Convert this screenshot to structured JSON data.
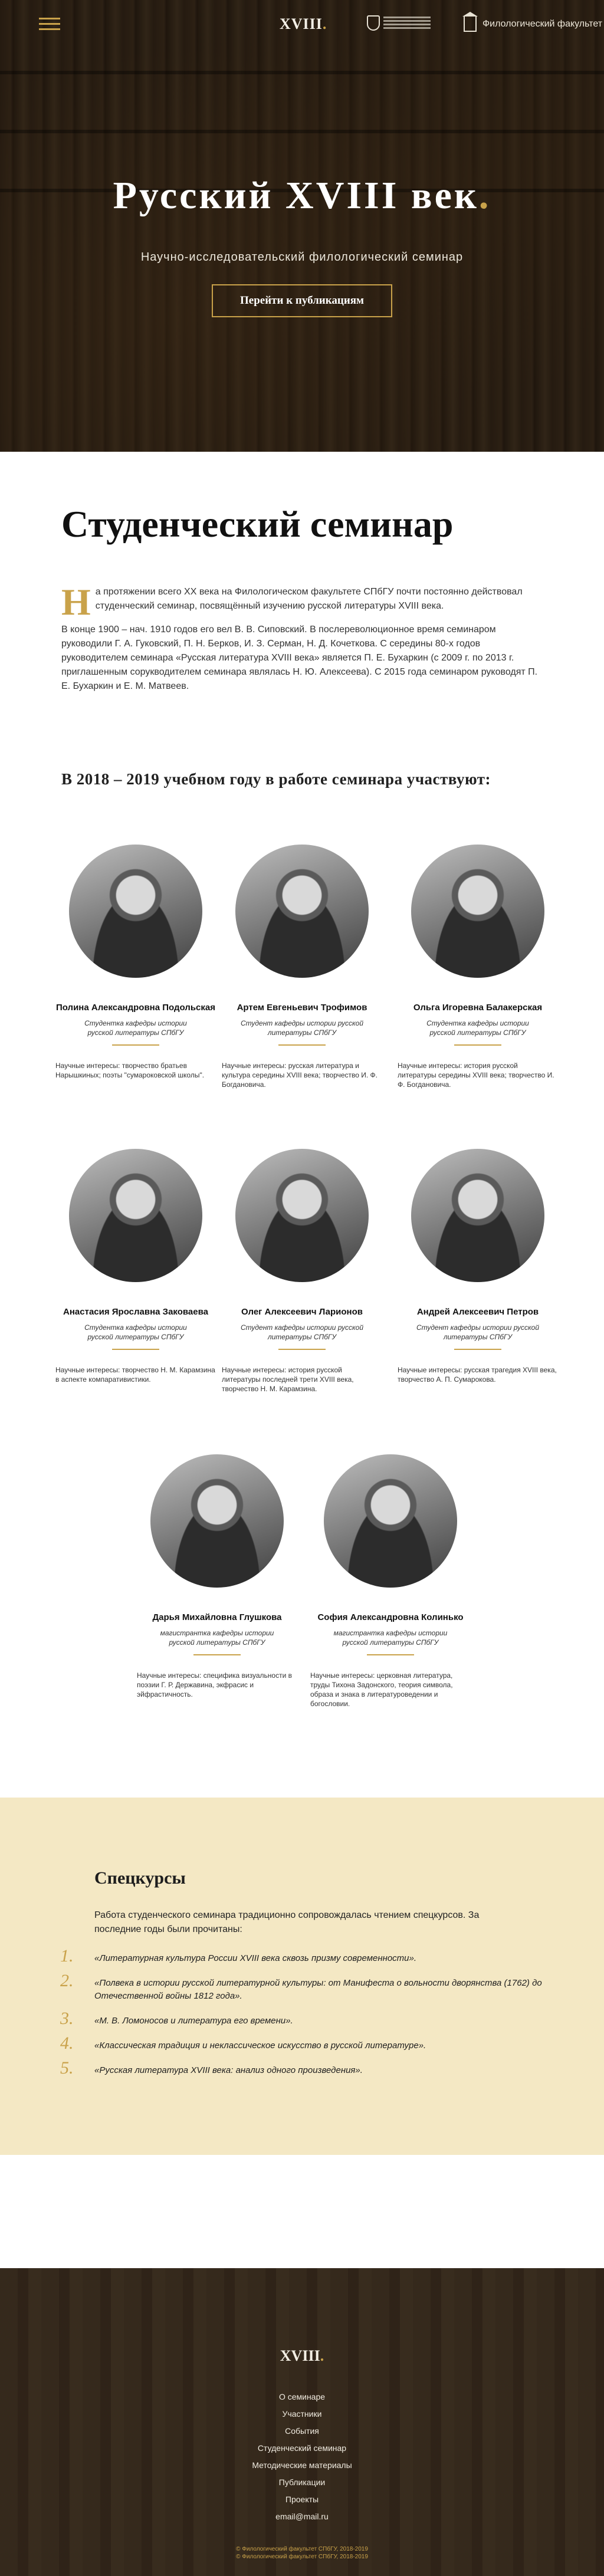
{
  "hero": {
    "logo_text": "XVIII",
    "logo_dot": ".",
    "faculty": "Филологический факультет",
    "title": "Русский XVIII век",
    "title_dot": ".",
    "subtitle": "Научно-исследовательский филологический семинар",
    "button": "Перейти к публикациям"
  },
  "intro": {
    "heading": "Студенческий семинар",
    "dropcap": "Н",
    "paragraph1": "а протяжении всего XX века на Филологическом факультете СПбГУ почти постоянно действовал студенческий семинар, посвящённый изучению русской литературы XVIII века.",
    "paragraph2": "В конце 1900 – нач. 1910 годов его вел В. В. Сиповский. В послереволюционное время семинаром руководили Г. А. Гуковский, П. Н. Берков, И. З. Серман, Н. Д. Кочеткова. С середины 80-х годов руководителем семинара «Русская литература XVIII века» является П. Е. Бухаркин (с 2009 г. по 2013 г. приглашенным сорукводителем семинара являлась Н. Ю. Алексеева). С 2015 года семинаром руководят П. Е. Бухаркин и Е. М. Матвеев.",
    "year_heading": "В 2018 – 2019 учебном году в работе семинара участвуют:"
  },
  "people": [
    {
      "name": "Полина Александровна Подольская",
      "role": "Студентка кафедры истории русской литературы СПбГУ",
      "interests": "Научные интересы: творчество братьев Нарышкиных; поэты \"сумароковской школы\"."
    },
    {
      "name": "Артем Евгеньевич Трофимов",
      "role": "Студент кафедры истории русской литературы СПбГУ",
      "interests": "Научные интересы: русская литература и культура середины XVIII века; творчество И. Ф. Богдановича."
    },
    {
      "name": "Ольга Игоревна Балакерская",
      "role": "Студентка кафедры истории русской литературы СПбГУ",
      "interests": "Научные интересы: история русской литературы середины XVIII века; творчество И. Ф. Богдановича."
    },
    {
      "name": "Анастасия Ярославна Заковаева",
      "role": "Студентка кафедры истории русской литературы СПбГУ",
      "interests": "Научные интересы: творчество Н. М. Карамзина в аспекте компаративистики."
    },
    {
      "name": "Олег Алексеевич Ларионов",
      "role": "Студент кафедры истории русской литературы СПбГУ",
      "interests": "Научные интересы: история русской литературы последней трети XVIII века, творчество Н. М. Карамзина."
    },
    {
      "name": "Андрей Алексеевич Петров",
      "role": "Студент кафедры истории русской литературы СПбГУ",
      "interests": "Научные интересы: русская трагедия XVIII века, творчество А. П. Сумарокова."
    },
    {
      "name": "Дарья Михайловна Глушкова",
      "role": "магистрантка кафедры истории русской литературы СПбГУ",
      "interests": "Научные интересы: специфика визуальности в поэзии Г. Р. Державина, экфрасис и эйфрастичность."
    },
    {
      "name": "София Александровна Колинько",
      "role": "магистрантка кафедры истории русской литературы СПбГУ",
      "interests": "Научные интересы: церковная литература, труды Тихона Задонского, теория символа, образа и знака в литературоведении и богословии."
    }
  ],
  "courses": {
    "heading": "Спецкурсы",
    "lead": "Работа студенческого семинара традиционно сопровождалась чтением спецкурсов. За последние годы были прочитаны:",
    "items": [
      {
        "num": "1.",
        "text": "«Литературная культура России XVIII века сквозь призму современности»."
      },
      {
        "num": "2.",
        "text": "«Полвека в истории русской литературной культуры: от Манифеста  о вольности дворянства (1762) до Отечественной войны 1812 года»."
      },
      {
        "num": "3.",
        "text": "«М. В. Ломоносов и литература его времени»."
      },
      {
        "num": "4.",
        "text": "«Классическая традиция и неклассическое искусство в русской литературе»."
      },
      {
        "num": "5.",
        "text": "«Русская литература XVIII века: анализ одного произведения»."
      }
    ]
  },
  "footer": {
    "logo_text": "XVIII",
    "logo_dot": ".",
    "nav": [
      "О семинаре",
      "Участники",
      "События",
      "Студенческий семинар",
      "Методические материалы",
      "Публикации",
      "Проекты",
      "email@mail.ru"
    ],
    "copyright_line1": "© Филологический факультет СПбГУ, 2018-2019",
    "copyright_line2": "© Филологический факультет СПбГУ, 2018-2019"
  },
  "colors": {
    "accent": "#c9a24a",
    "courses_bg": "#f4e8c4"
  }
}
